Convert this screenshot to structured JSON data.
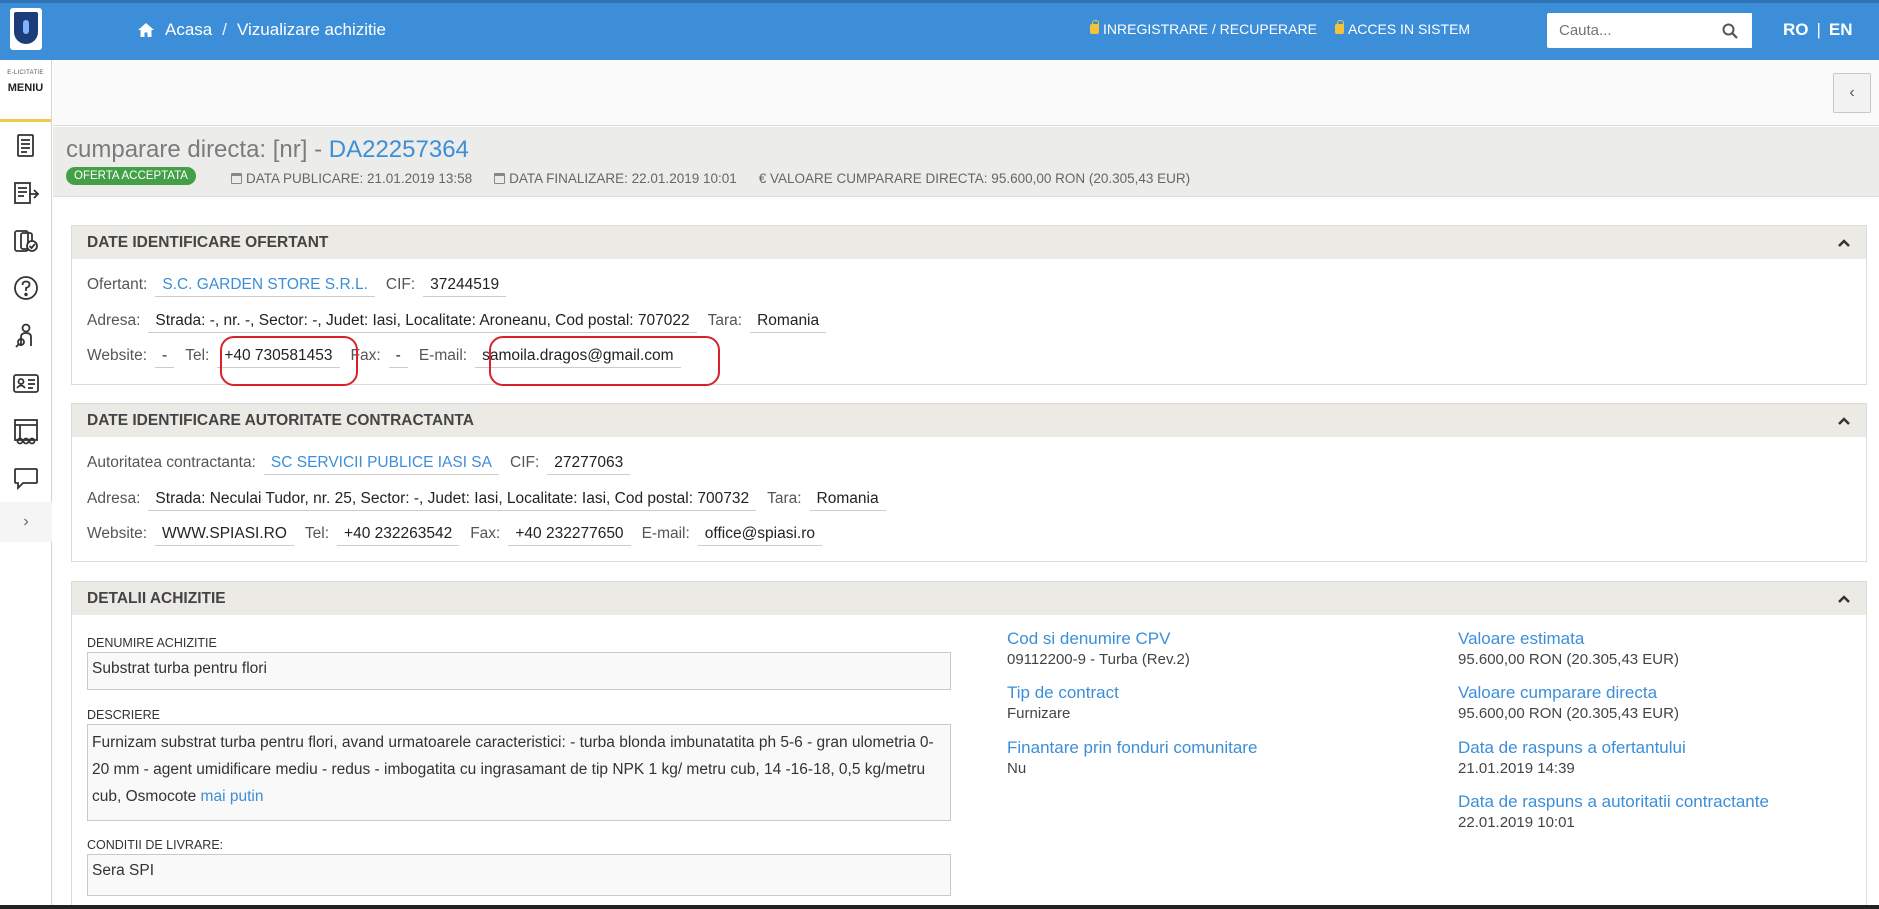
{
  "header": {
    "breadcrumb_home": "Acasa",
    "breadcrumb_sep": "/",
    "breadcrumb_current": "Vizualizare achizitie",
    "register_link": "INREGISTRARE / RECUPERARE",
    "login_link": "ACCES IN SISTEM",
    "search_placeholder": "Cauta...",
    "lang_ro": "RO",
    "lang_sep": "|",
    "lang_en": "EN"
  },
  "sidebar": {
    "brand_small": "E-LICITATIE",
    "menu_label": "MENIU",
    "icons": [
      "documents-icon",
      "list-export-icon",
      "clipboard-check-icon",
      "help-icon",
      "user-search-icon",
      "id-card-icon",
      "catalog-icon",
      "chat-icon"
    ],
    "expand": "›"
  },
  "collapse_button": "‹",
  "procurement": {
    "title_prefix": "cumparare directa: [nr] - ",
    "code": "DA22257364",
    "status": "OFERTA ACCEPTATA",
    "publish_date": "DATA PUBLICARE: 21.01.2019 13:58",
    "final_date": "DATA FINALIZARE: 22.01.2019 10:01",
    "value": "€ VALOARE CUMPARARE DIRECTA: 95.600,00  RON (20.305,43  EUR)"
  },
  "bidder_panel": {
    "title": "DATE IDENTIFICARE OFERTANT",
    "labels": {
      "bidder": "Ofertant:",
      "cif": "CIF:",
      "address": "Adresa:",
      "country": "Tara:",
      "website": "Website:",
      "tel": "Tel:",
      "fax": "Fax:",
      "email": "E-mail:"
    },
    "name": "S.C. GARDEN STORE S.R.L.",
    "cif": "37244519",
    "address": "Strada: -, nr. -, Sector: -, Judet: Iasi, Localitate: Aroneanu, Cod postal: 707022",
    "country": "Romania",
    "website": "-",
    "tel": "+40 730581453",
    "fax": "-",
    "email": "samoila.dragos@gmail.com"
  },
  "authority_panel": {
    "title": "DATE IDENTIFICARE AUTORITATE CONTRACTANTA",
    "labels": {
      "authority": "Autoritatea contractanta:",
      "cif": "CIF:",
      "address": "Adresa:",
      "country": "Tara:",
      "website": "Website:",
      "tel": "Tel:",
      "fax": "Fax:",
      "email": "E-mail:"
    },
    "name": "SC SERVICII PUBLICE IASI SA",
    "cif": "27277063",
    "address": "Strada: Neculai Tudor, nr. 25, Sector: -, Judet: Iasi, Localitate: Iasi, Cod postal: 700732",
    "country": "Romania",
    "website": "WWW.SPIASI.RO",
    "tel": "+40 232263542",
    "fax": "+40 232277650",
    "email": "office@spiasi.ro"
  },
  "details_panel": {
    "title": "DETALII ACHIZITIE",
    "name_label": "DENUMIRE ACHIZITIE",
    "name_value": "Substrat turba pentru flori",
    "desc_label": "DESCRIERE",
    "desc_value": "Furnizam substrat turba pentru flori, avand urmatoarele caracteristici: - turba blonda imbunatatita ph 5-6 - gran ulometria 0-20 mm - agent umidificare mediu - redus - imbogatita cu ingrasamant de tip NPK 1 kg/ metru cub, 14 -16-18, 0,5 kg/metru cub, Osmocote ",
    "desc_more": "mai putin",
    "delivery_label": "CONDITII DE LIVRARE:",
    "delivery_value": "Sera SPI",
    "cpv_label": "Cod si denumire CPV",
    "cpv_value": "09112200-9 - Turba (Rev.2)",
    "contract_type_label": "Tip de contract",
    "contract_type_value": "Furnizare",
    "eu_funds_label": "Finantare prin fonduri comunitare",
    "eu_funds_value": "Nu",
    "estimated_label": "Valoare estimata",
    "estimated_value": "95.600,00  RON (20.305,43  EUR)",
    "direct_value_label": "Valoare cumparare directa",
    "direct_value_value": "95.600,00  RON (20.305,43  EUR)",
    "bidder_reply_label": "Data de raspuns a ofertantului",
    "bidder_reply_value": "21.01.2019 14:39",
    "authority_reply_label": "Data de raspuns a autoritatii contractante",
    "authority_reply_value": "22.01.2019 10:01"
  },
  "colors": {
    "header": "#3c8ed8",
    "badge": "#43a047",
    "circle": "#d8232a"
  }
}
